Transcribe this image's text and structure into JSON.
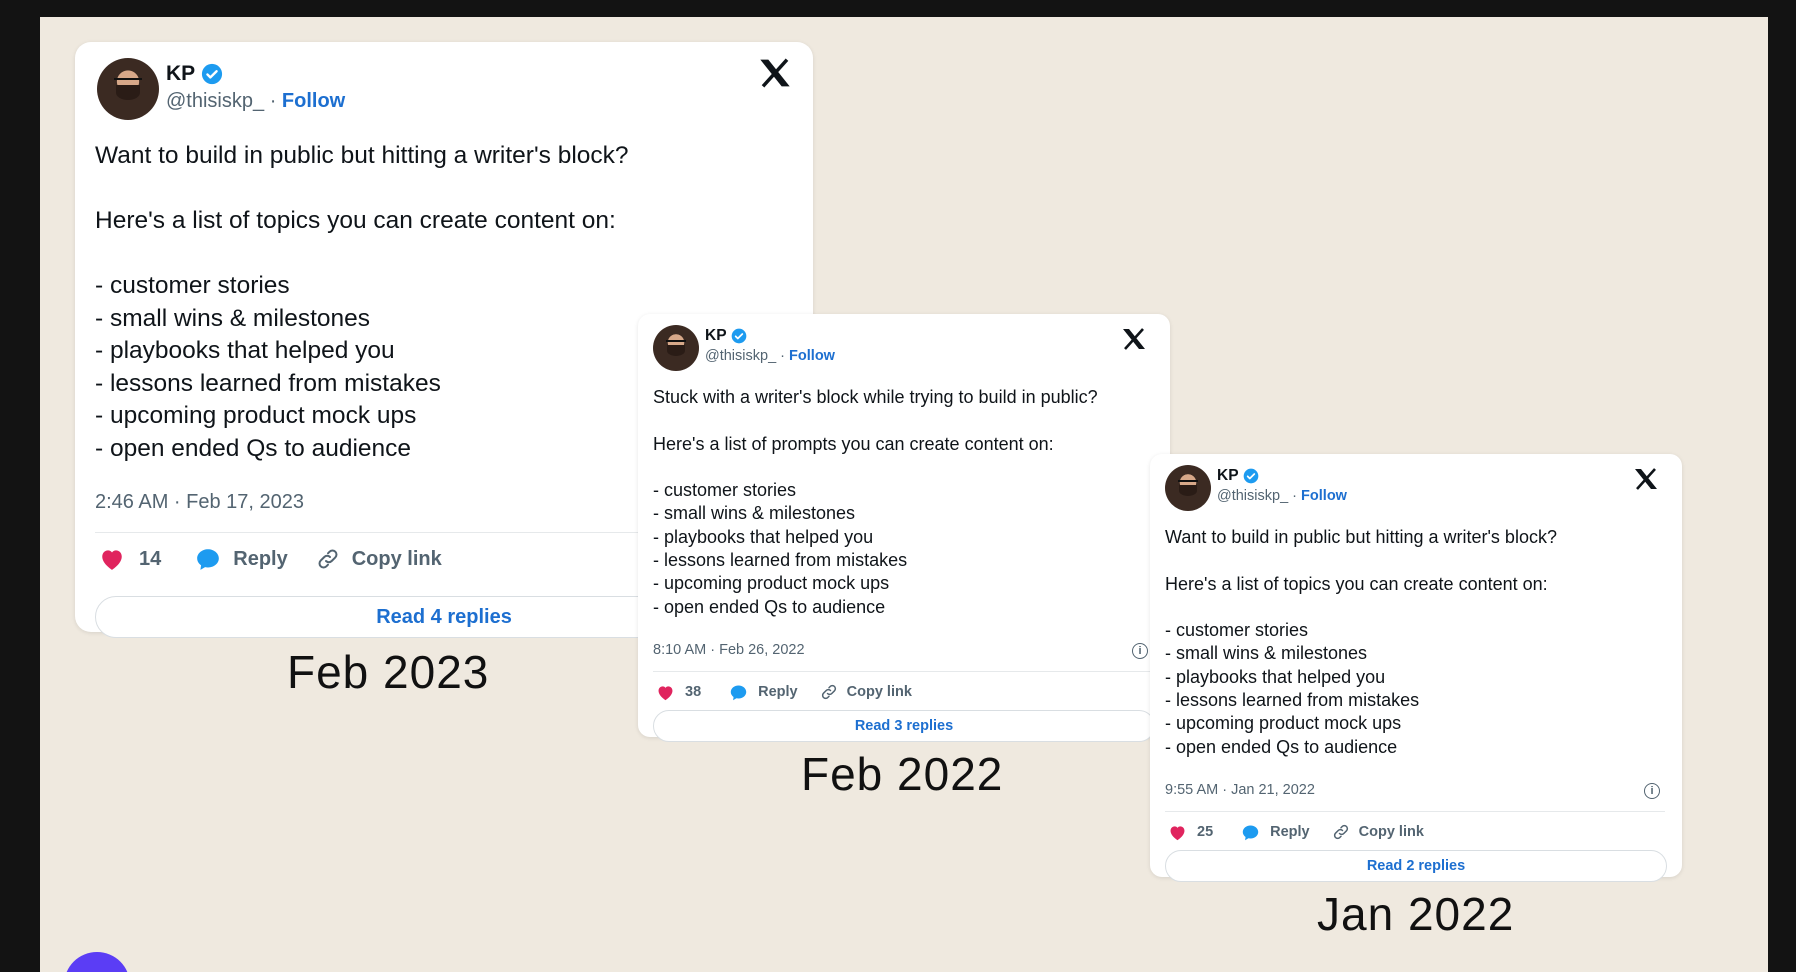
{
  "tweets": [
    {
      "author": "KP",
      "handle": "@thisiskp_",
      "follow_label": "Follow",
      "separator": "·",
      "text": "Want to build in public but hitting a writer's block?\n\nHere's a list of topics you can create content on:\n\n- customer stories\n- small wins & milestones\n- playbooks that helped you\n- lessons learned from mistakes\n- upcoming product mock ups\n- open ended Qs to audience",
      "timestamp": "2:46 AM · Feb 17, 2023",
      "likes": "14",
      "reply_label": "Reply",
      "copy_label": "Copy link",
      "read_replies": "Read 4 replies",
      "caption": "Feb 2023"
    },
    {
      "author": "KP",
      "handle": "@thisiskp_",
      "follow_label": "Follow",
      "separator": "·",
      "text": "Stuck with a writer's block while trying to build in public?\n\nHere's a list of prompts you can create content on:\n\n- customer stories\n- small wins & milestones\n- playbooks that helped you\n- lessons learned from mistakes\n- upcoming product mock ups\n- open ended Qs to audience",
      "timestamp": "8:10 AM · Feb 26, 2022",
      "likes": "38",
      "reply_label": "Reply",
      "copy_label": "Copy link",
      "read_replies": "Read 3 replies",
      "caption": "Feb 2022"
    },
    {
      "author": "KP",
      "handle": "@thisiskp_",
      "follow_label": "Follow",
      "separator": "·",
      "text": "Want to build in public but hitting a writer's block?\n\nHere's a list of topics you can create content on:\n\n- customer stories\n- small wins & milestones\n- playbooks that helped you\n- lessons learned from mistakes\n- upcoming product mock ups\n- open ended Qs to audience",
      "timestamp": "9:55 AM · Jan 21, 2022",
      "likes": "25",
      "reply_label": "Reply",
      "copy_label": "Copy link",
      "read_replies": "Read 2 replies",
      "caption": "Jan 2022"
    }
  ],
  "icons": {
    "logo": "x-logo-icon",
    "verified": "verified-badge-icon",
    "like": "heart-icon",
    "reply": "reply-bubble-icon",
    "copy": "link-icon",
    "info": "info-icon"
  },
  "colors": {
    "background": "#efe9df",
    "link": "#1d6fd0",
    "like": "#e0245e",
    "reply": "#1d9bf0",
    "fab": "#5b3df5"
  }
}
